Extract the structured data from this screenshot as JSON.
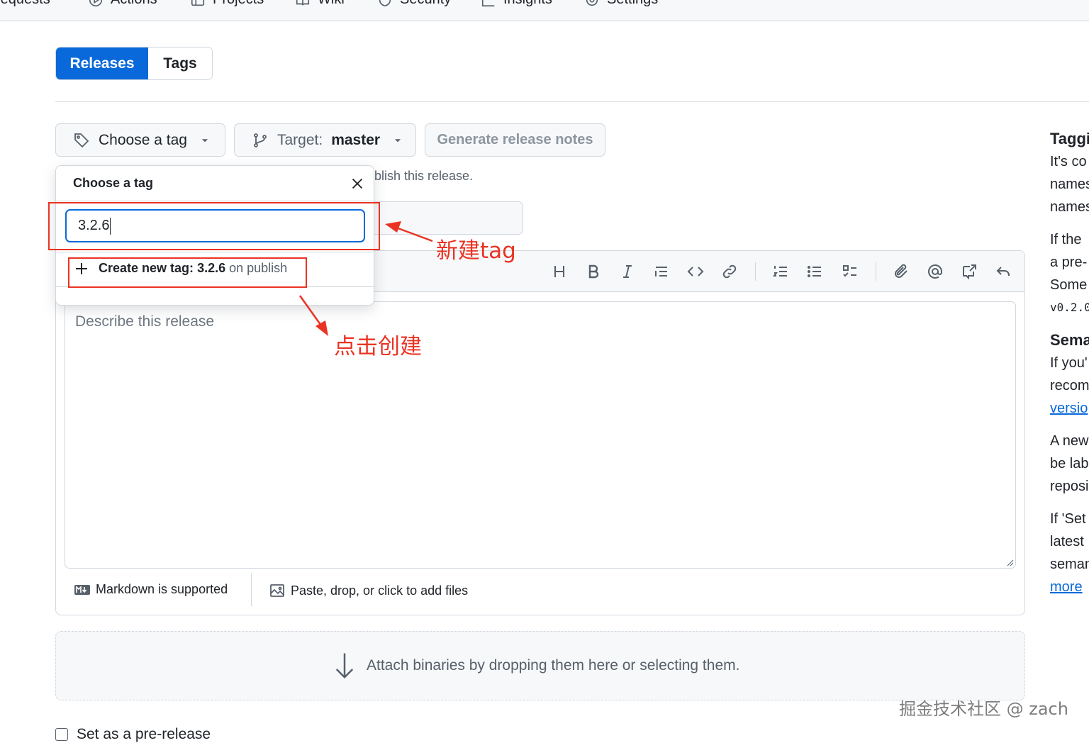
{
  "nav": {
    "items": [
      {
        "label": "requests",
        "icon": "pull-request-icon"
      },
      {
        "label": "Actions",
        "icon": "play-circle-icon"
      },
      {
        "label": "Projects",
        "icon": "table-icon"
      },
      {
        "label": "Wiki",
        "icon": "book-icon"
      },
      {
        "label": "Security",
        "icon": "shield-icon"
      },
      {
        "label": "Insights",
        "icon": "graph-icon"
      },
      {
        "label": "Settings",
        "icon": "gear-icon"
      }
    ]
  },
  "tabs": {
    "releases": "Releases",
    "tags": "Tags"
  },
  "controls": {
    "choose_tag": "Choose a tag",
    "target_label": "Target:",
    "target_value": "master",
    "generate_notes": "Generate release notes"
  },
  "helper_text": "blish this release.",
  "tag_dropdown": {
    "title": "Choose a tag",
    "input_value": "3.2.6",
    "create_prefix": "Create new tag:",
    "create_tag": "3.2.6",
    "create_suffix": "on publish"
  },
  "annotations": {
    "new_tag": "新建tag",
    "click_create": "点击创建"
  },
  "editor": {
    "placeholder": "Describe this release",
    "markdown_note": "Markdown is supported",
    "attach_files": "Paste, drop, or click to add files"
  },
  "attach_binaries": "Attach binaries by dropping them here or selecting them.",
  "prerelease_label": "Set as a pre-release",
  "sidebar": {
    "heading1": "Taggi",
    "p1": [
      "It's co",
      "names",
      "names"
    ],
    "p2": [
      "If the",
      "a pre-",
      "Some"
    ],
    "code": "v0.2.0",
    "heading2": "Sema",
    "p3": [
      "If you'",
      "recom"
    ],
    "link1": "versio",
    "p4": [
      "A new",
      "be lab",
      "reposi"
    ],
    "p5": [
      "If 'Set",
      "latest",
      "seman"
    ],
    "link2": "more"
  },
  "watermark": "掘金技术社区 @ zach",
  "colors": {
    "accent": "#0969da",
    "annotation": "#ea3323",
    "border": "#d0d7de"
  }
}
